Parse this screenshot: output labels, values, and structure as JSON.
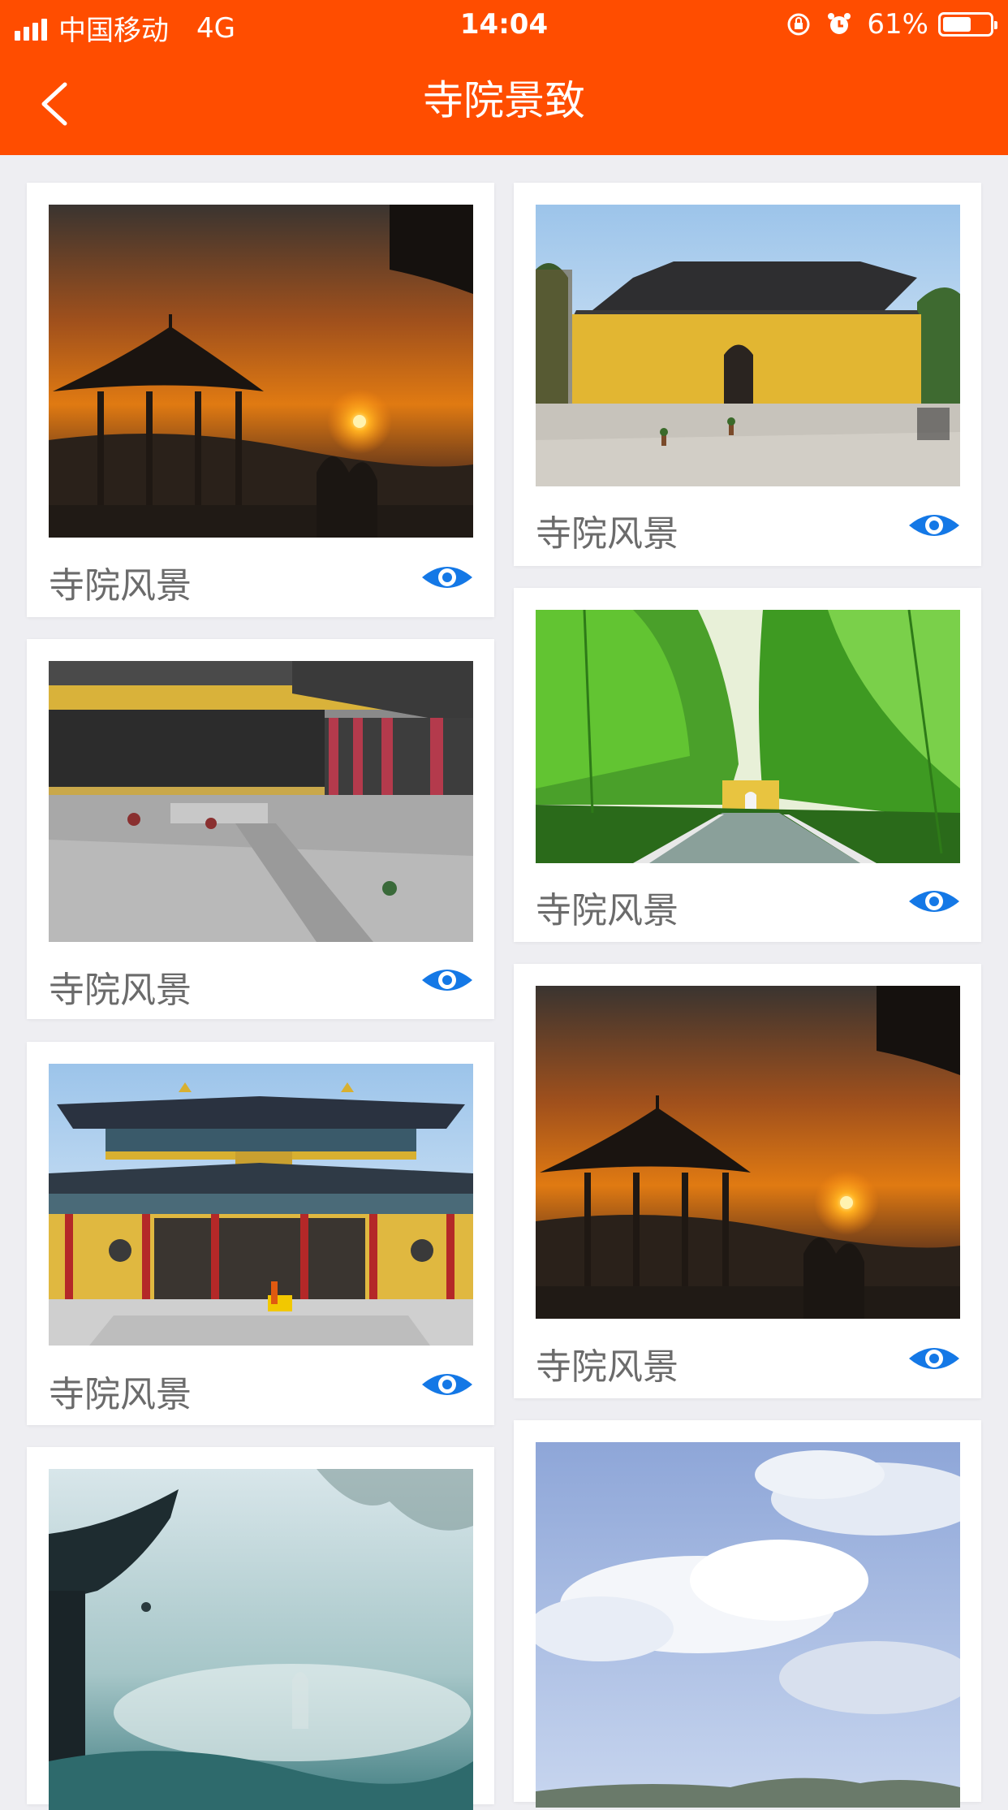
{
  "status_bar": {
    "carrier": "中国移动",
    "network": "4G",
    "time": "14:04",
    "battery": "61%",
    "battery_level": 0.61
  },
  "header": {
    "title": "寺院景致",
    "background": "#ff4d00"
  },
  "accent_color": "#1478e6",
  "cards": [
    {
      "caption": "寺院风景",
      "scene": "pavilion-sunset",
      "icon": "eye-icon"
    },
    {
      "caption": "寺院风景",
      "scene": "yellow-temple-gate",
      "icon": "eye-icon"
    },
    {
      "caption": "寺院风景",
      "scene": "temple-courtyard",
      "icon": "eye-icon"
    },
    {
      "caption": "寺院风景",
      "scene": "bamboo-path",
      "icon": "eye-icon"
    },
    {
      "caption": "寺院风景",
      "scene": "temple-main-hall",
      "icon": "eye-icon"
    },
    {
      "caption": "寺院风景",
      "scene": "pavilion-sunset",
      "icon": "eye-icon"
    },
    {
      "caption": "",
      "scene": "misty-temple-eaves",
      "icon": ""
    },
    {
      "caption": "",
      "scene": "sky-clouds",
      "icon": ""
    }
  ]
}
